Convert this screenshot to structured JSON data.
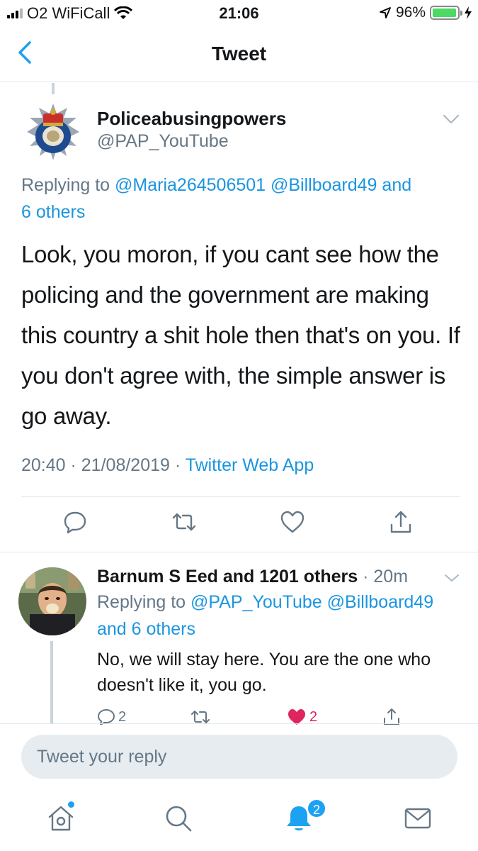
{
  "status_bar": {
    "carrier": "O2 WiFiCall",
    "time": "21:06",
    "battery": "96%",
    "battery_level": 0.96
  },
  "header": {
    "title": "Tweet"
  },
  "tweet": {
    "author_name": "Policeabusingpowers",
    "author_handle": "@PAP_YouTube",
    "replying_prefix": "Replying to ",
    "replying_users": "@Maria264506501 @Billboard49",
    "replying_and": " and",
    "replying_others": "6 others",
    "text": "Look, you moron, if you cant see how the policing and the government are making this country a shit hole then that's on you. If you don't agree with, the simple answer is go away.",
    "time": "20:40",
    "date": "21/08/2019",
    "source": "Twitter Web App",
    "separator": " · "
  },
  "reply": {
    "author": "Barnum S Eed and 1201 others",
    "time": "20m",
    "separator": " · ",
    "replying_prefix": "Replying to ",
    "replying_users": "@PAP_YouTube @Billboard49",
    "replying_others": "and 6 others",
    "text": "No, we will stay here. You are the one who doesn't like it, you go.",
    "reply_count": "2",
    "like_count": "2"
  },
  "composer": {
    "placeholder": "Tweet your reply"
  },
  "tabbar": {
    "notifications_count": "2"
  },
  "colors": {
    "accent": "#1da1f2",
    "link": "#1b95e0",
    "muted": "#657786",
    "like": "#e0245e"
  }
}
